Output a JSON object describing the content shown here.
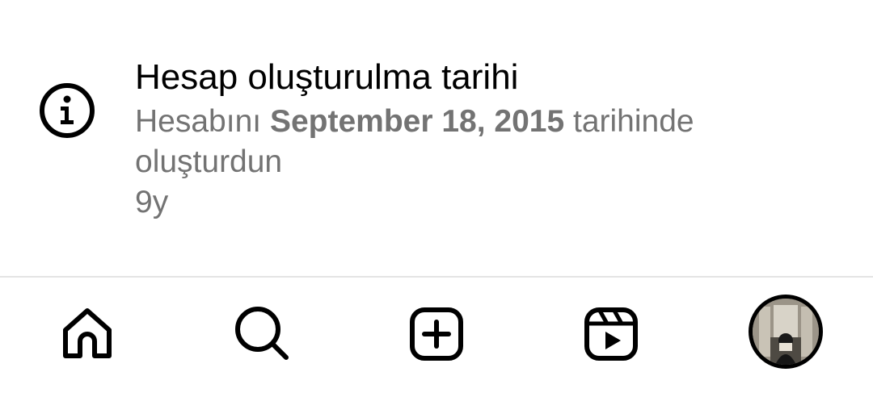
{
  "account_info": {
    "icon": "info-circle-icon",
    "title": "Hesap oluşturulma tarihi",
    "desc_prefix": "Hesabını ",
    "desc_date": "September 18, 2015",
    "desc_suffix": " tarihinde oluşturdun",
    "age": "9y"
  },
  "bottom_nav": {
    "items": [
      {
        "name": "home",
        "icon": "home-icon"
      },
      {
        "name": "search",
        "icon": "search-icon"
      },
      {
        "name": "create",
        "icon": "plus-square-icon"
      },
      {
        "name": "reels",
        "icon": "reels-icon"
      },
      {
        "name": "profile",
        "icon": "avatar"
      }
    ]
  },
  "colors": {
    "primary_text": "#000000",
    "secondary_text": "#737373",
    "divider": "#e4e4e4",
    "background": "#ffffff"
  }
}
